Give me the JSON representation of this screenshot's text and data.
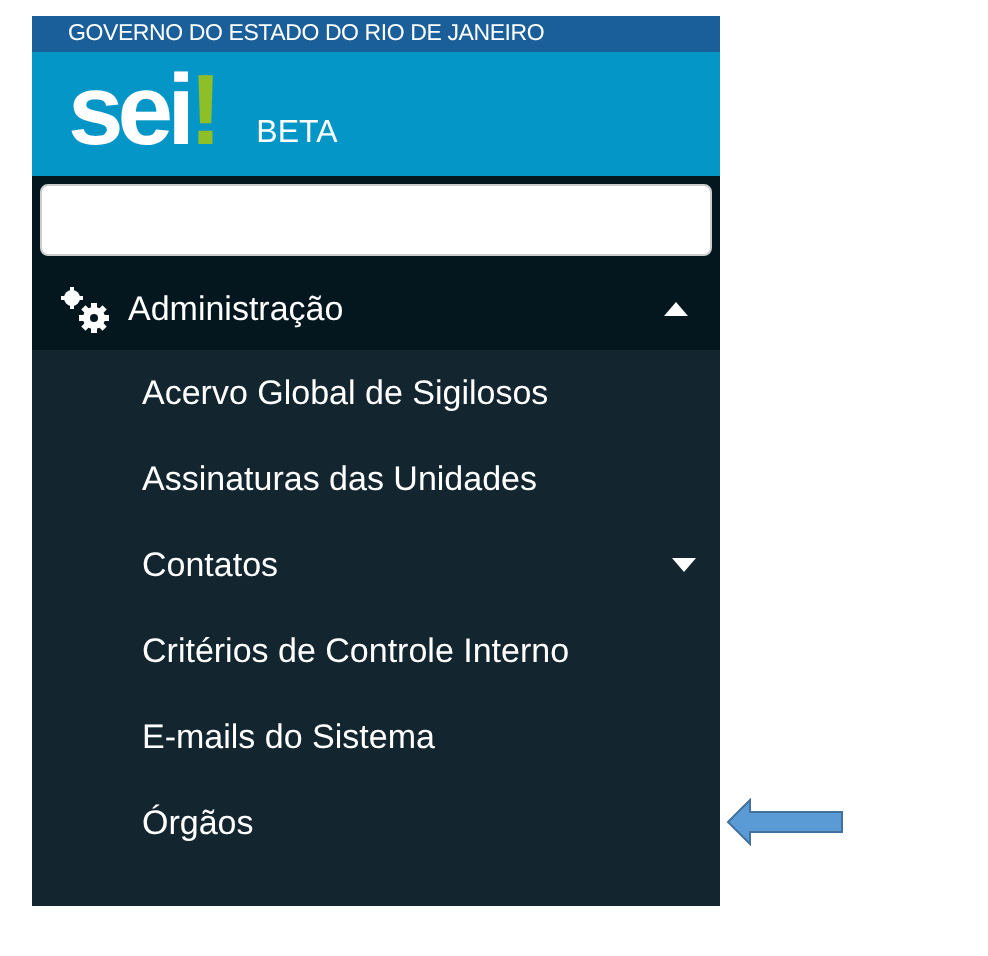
{
  "header": {
    "government": "GOVERNO DO ESTADO DO RIO DE JANEIRO",
    "logo": {
      "text": "sei",
      "mark": "!"
    },
    "edition": "BETA"
  },
  "menu": {
    "label": "Administração",
    "expanded": true,
    "items": [
      {
        "label": "Acervo Global de Sigilosos"
      },
      {
        "label": "Assinaturas das Unidades"
      },
      {
        "label": "Contatos",
        "expanded": false
      },
      {
        "label": "Critérios de Controle Interno"
      },
      {
        "label": "E-mails do Sistema"
      },
      {
        "label": "Órgãos"
      }
    ]
  }
}
